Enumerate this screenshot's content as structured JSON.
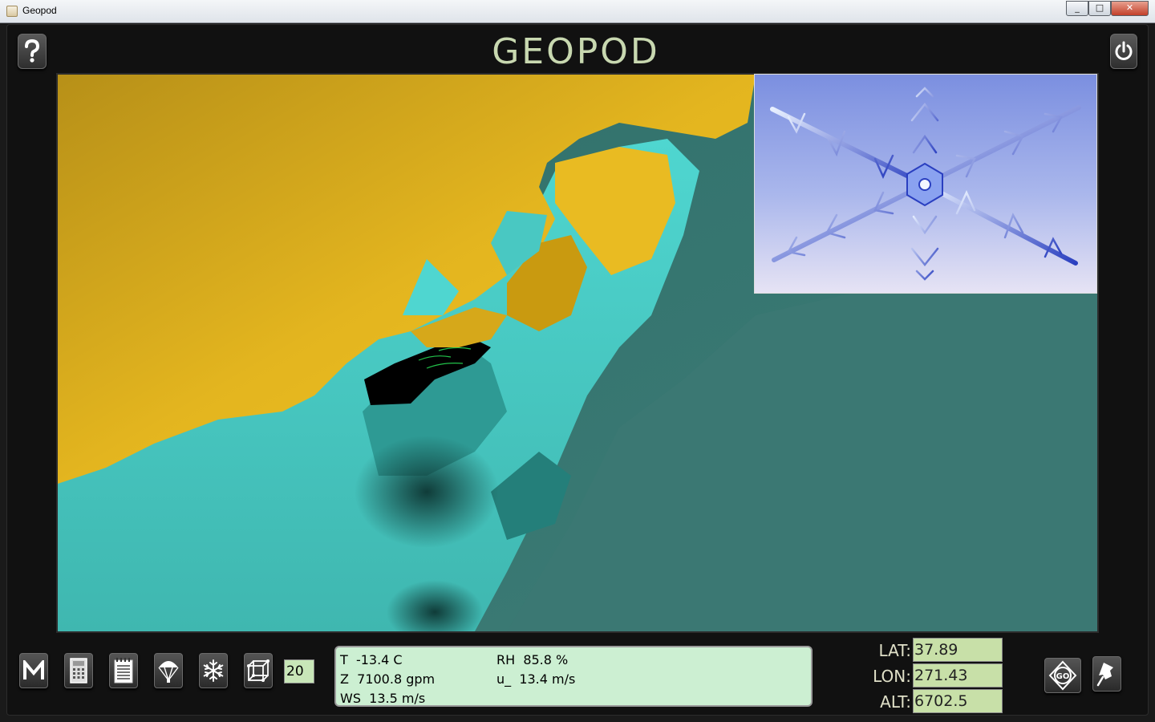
{
  "window": {
    "title": "Geopod",
    "minimize": "_",
    "maximize": "□",
    "close": "✕"
  },
  "header": {
    "logo_text": "GEOPOD"
  },
  "icons": {
    "help": "question-icon",
    "power": "power-icon",
    "menu": "m-letter-icon",
    "calculator": "calculator-icon",
    "notepad": "notepad-icon",
    "parachute": "parachute-icon",
    "snowflake": "snowflake-icon",
    "grid": "grid-box-icon",
    "go": "go-compass-icon",
    "pin": "pushpin-icon"
  },
  "toolbar": {
    "step_value": "20"
  },
  "readout": {
    "t": "T  -13.4 C",
    "z": "Z  7100.8 gpm",
    "ws": "WS  13.5 m/s",
    "rh": "RH  85.8 %",
    "u": "u_  13.4 m/s"
  },
  "coords": {
    "lat_label": "LAT:",
    "lat_value": "37.89",
    "lon_label": "LON:",
    "lon_value": "271.43",
    "alt_label": "ALT:",
    "alt_value": "6702.5"
  },
  "colors": {
    "isosurface_yellow": "#e0b21c",
    "isosurface_cyan": "#4fd6d0",
    "isosurface_teal": "#3f7a74",
    "readout_bg": "#ccefd2",
    "logo": "#c8d8b0"
  }
}
